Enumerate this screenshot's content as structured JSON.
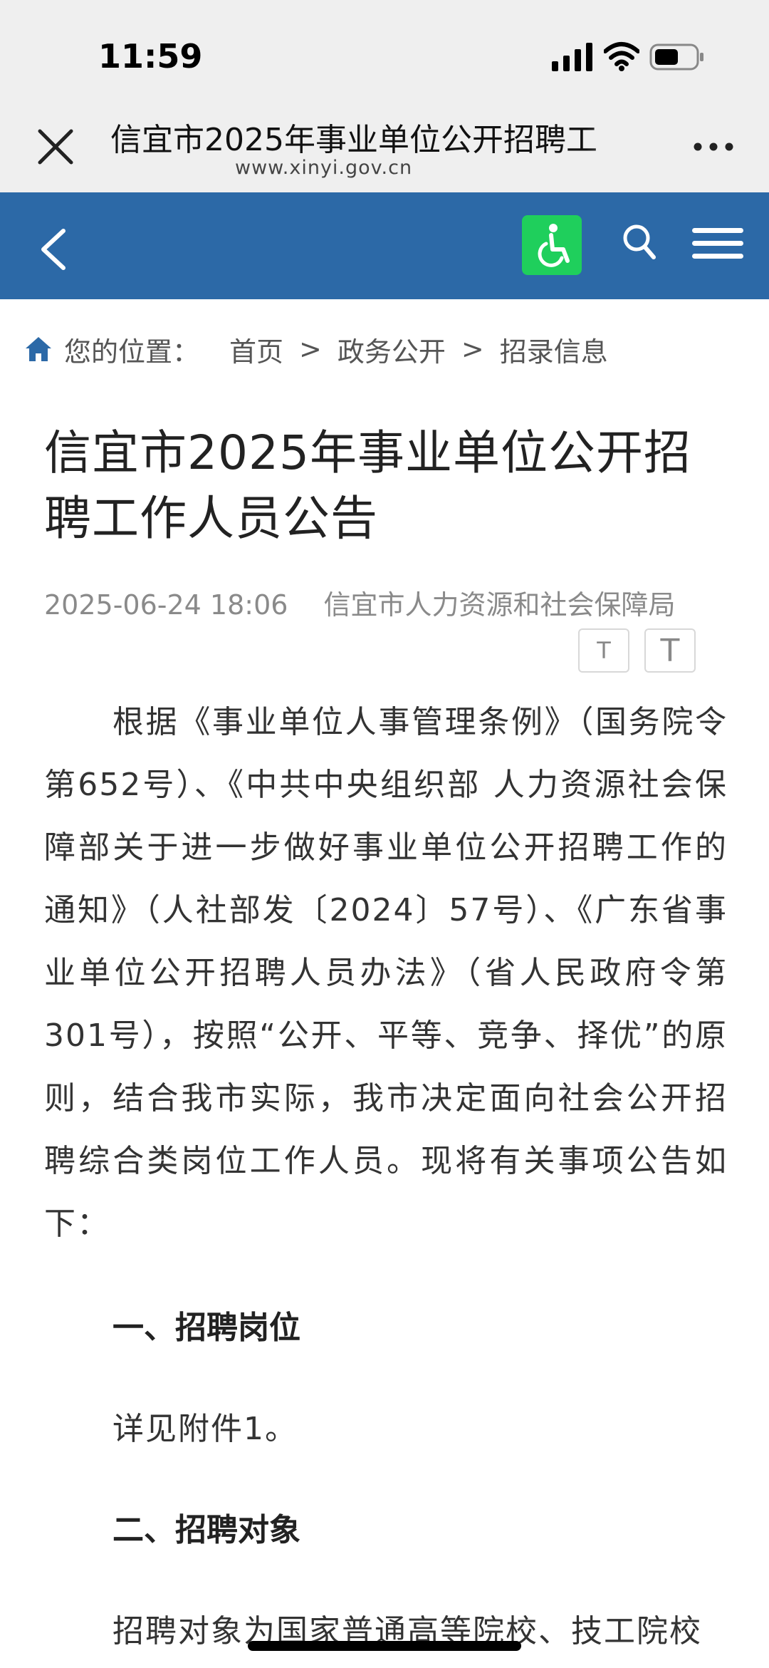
{
  "status_bar": {
    "time": "11:59"
  },
  "browser": {
    "tab_title": "信宜市2025年事业单位公开招聘工",
    "url": "www.xinyi.gov.cn"
  },
  "breadcrumb": {
    "prefix": "您的位置：",
    "items": [
      "首页",
      "政务公开",
      "招录信息"
    ],
    "separator": ">"
  },
  "article": {
    "title": "信宜市2025年事业单位公开招聘工作人员公告",
    "datetime": "2025-06-24 18:06",
    "source": "信宜市人力资源和社会保障局",
    "font_small_label": "T",
    "font_large_label": "T",
    "intro": "根据《事业单位人事管理条例》（国务院令第652号）、《中共中央组织部 人力资源社会保障部关于进一步做好事业单位公开招聘工作的通知》（人社部发〔2024〕57号）、《广东省事业单位公开招聘人员办法》（省人民政府令第301号），按照“公开、平等、竞争、择优”的原则，结合我市实际，我市决定面向社会公开招聘综合类岗位工作人员。现将有关事项公告如下：",
    "sections": [
      {
        "heading": "一、招聘岗位",
        "text": "详见附件1。"
      },
      {
        "heading": "二、招聘对象",
        "text": "招聘对象为国家普通高等院校、技工院校"
      }
    ]
  },
  "colors": {
    "nav_bg": "#2c69a7",
    "accessibility_bg": "#1fcf5c",
    "browser_bg": "#efefef"
  },
  "icons": [
    "close-icon",
    "more-icon",
    "back-icon",
    "accessibility-icon",
    "search-icon",
    "menu-icon",
    "home-icon"
  ]
}
